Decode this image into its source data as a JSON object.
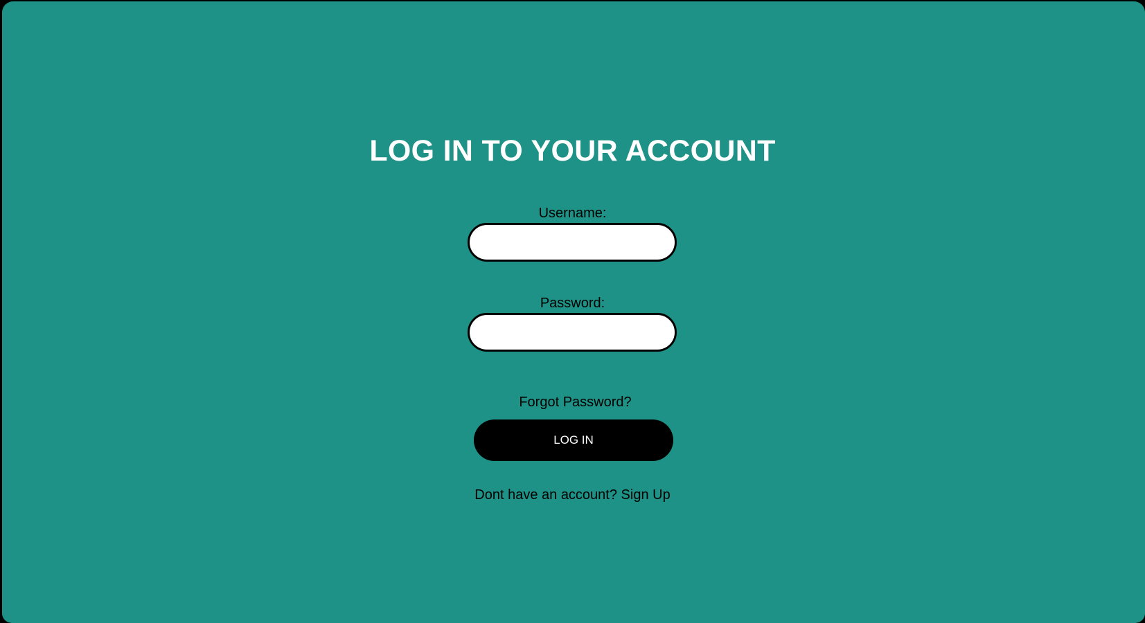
{
  "colors": {
    "background": "#1e9286",
    "frame": "#000000",
    "title_text": "#ffffff",
    "input_bg": "#ffffff",
    "button_bg": "#000000",
    "button_text": "#ffffff"
  },
  "login": {
    "title": "LOG IN TO YOUR ACCOUNT",
    "username_label": "Username:",
    "username_value": "",
    "password_label": "Password:",
    "password_value": "",
    "forgot_password": "Forgot Password?",
    "login_button": "LOG IN",
    "signup_prompt": "Dont have an account?",
    "signup_link": "Sign Up"
  }
}
